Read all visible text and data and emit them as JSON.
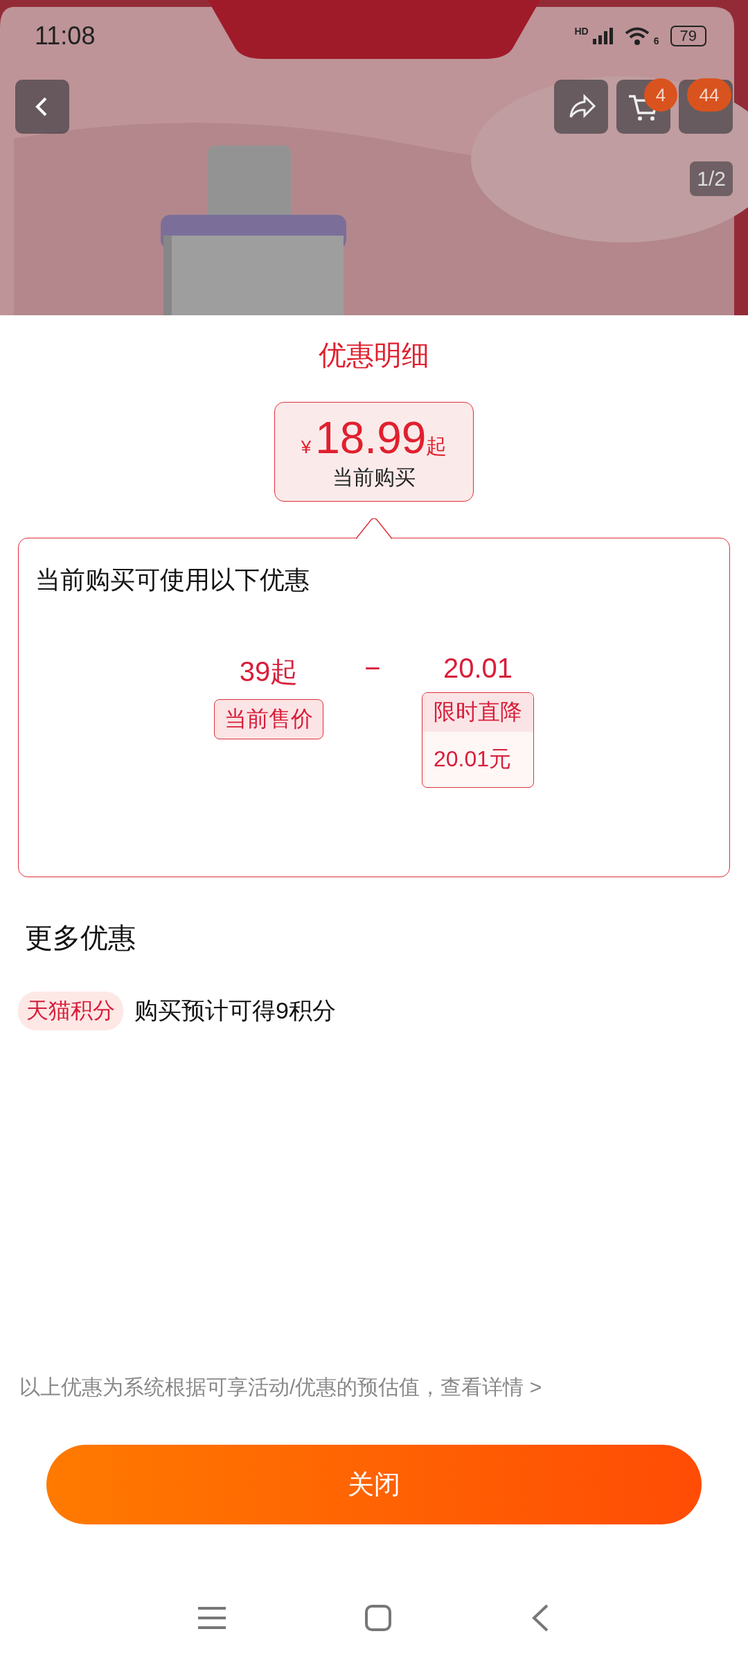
{
  "status_bar": {
    "time": "11:08",
    "network_label": "HD",
    "wifi_label": "6",
    "battery": "79"
  },
  "header": {
    "cart_badge": "4",
    "more_badge": "44",
    "image_counter": "1/2"
  },
  "sheet": {
    "title": "优惠明细",
    "price": {
      "currency": "¥",
      "amount": "18.99",
      "suffix": "起",
      "label": "当前购买"
    },
    "breakdown": {
      "heading": "当前购买可使用以下优惠",
      "items": [
        {
          "kind": "price",
          "value": "39起",
          "tag": "当前售价"
        },
        {
          "kind": "operator",
          "value": "−"
        },
        {
          "kind": "discount",
          "value": "20.01",
          "tag": "限时直降",
          "detail": "20.01元"
        }
      ]
    },
    "more": {
      "heading": "更多优惠",
      "rows": [
        {
          "tag": "天猫积分",
          "text": "购买预计可得9积分"
        }
      ]
    },
    "note": {
      "text": "以上优惠为系统根据可享活动/优惠的预估值，",
      "link": "查看详情 >"
    },
    "close_button": "关闭"
  }
}
